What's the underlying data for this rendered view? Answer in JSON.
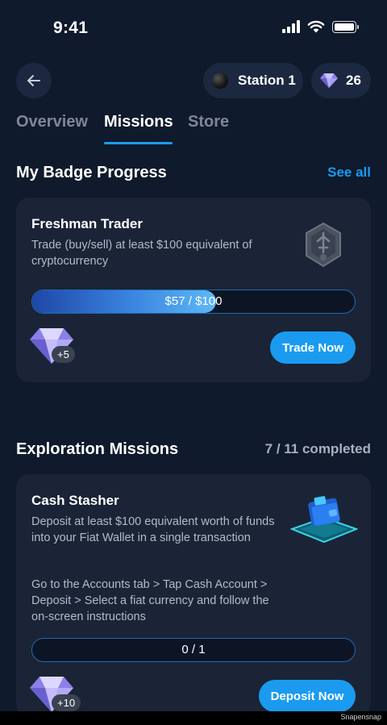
{
  "status_bar": {
    "time": "9:41",
    "icons": [
      "cellular-signal-icon",
      "wifi-icon",
      "battery-icon"
    ]
  },
  "header": {
    "back_icon": "arrow-left-icon",
    "station_label": "Station 1",
    "gem_count": "26"
  },
  "tabs": [
    {
      "label": "Overview",
      "active": false
    },
    {
      "label": "Missions",
      "active": true
    },
    {
      "label": "Store",
      "active": false
    }
  ],
  "badge_section": {
    "title": "My Badge Progress",
    "see_all": "See all",
    "card": {
      "title": "Freshman Trader",
      "description": "Trade (buy/sell) at least $100 equivalent of cryptocurrency",
      "progress_text": "$57 / $100",
      "progress_value": 0.57,
      "reward": "+5",
      "button": "Trade Now"
    }
  },
  "missions_section": {
    "title": "Exploration Missions",
    "completed": "7 / 11 completed",
    "card": {
      "title": "Cash Stasher",
      "description": "Deposit at least $100 equivalent worth of funds into your Fiat Wallet in a single transaction",
      "instructions": "Go to the Accounts tab > Tap Cash Account > Deposit > Select a fiat currency and follow the on-screen instructions",
      "progress_text": "0 / 1",
      "progress_value": 0,
      "reward": "+10",
      "button": "Deposit Now"
    }
  },
  "watermark": "Snapensnap",
  "colors": {
    "background": "#0f1a2c",
    "card": "#1a2436",
    "accent": "#1a9bf0",
    "muted": "#7d8799"
  }
}
